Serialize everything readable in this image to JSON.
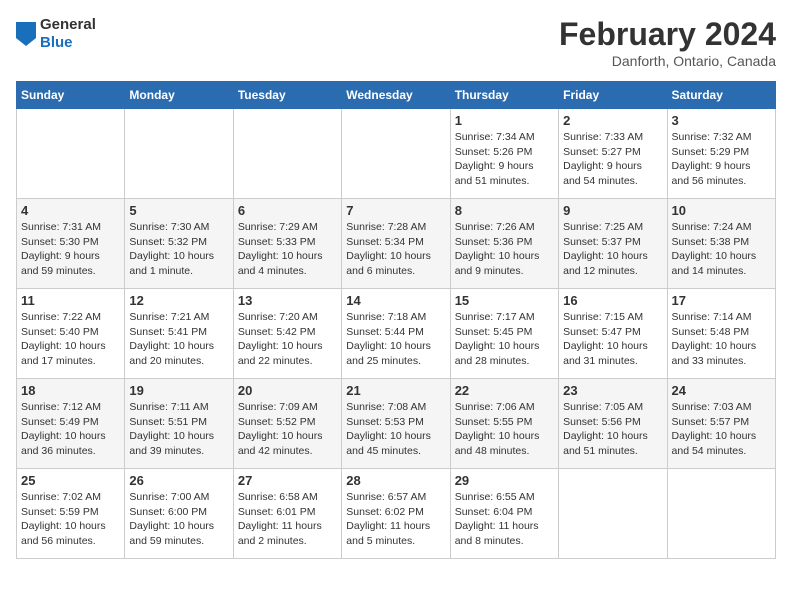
{
  "logo": {
    "line1": "General",
    "line2": "Blue"
  },
  "title": "February 2024",
  "subtitle": "Danforth, Ontario, Canada",
  "days_of_week": [
    "Sunday",
    "Monday",
    "Tuesday",
    "Wednesday",
    "Thursday",
    "Friday",
    "Saturday"
  ],
  "weeks": [
    [
      {
        "day": "",
        "info": ""
      },
      {
        "day": "",
        "info": ""
      },
      {
        "day": "",
        "info": ""
      },
      {
        "day": "",
        "info": ""
      },
      {
        "day": "1",
        "info": "Sunrise: 7:34 AM\nSunset: 5:26 PM\nDaylight: 9 hours\nand 51 minutes."
      },
      {
        "day": "2",
        "info": "Sunrise: 7:33 AM\nSunset: 5:27 PM\nDaylight: 9 hours\nand 54 minutes."
      },
      {
        "day": "3",
        "info": "Sunrise: 7:32 AM\nSunset: 5:29 PM\nDaylight: 9 hours\nand 56 minutes."
      }
    ],
    [
      {
        "day": "4",
        "info": "Sunrise: 7:31 AM\nSunset: 5:30 PM\nDaylight: 9 hours\nand 59 minutes."
      },
      {
        "day": "5",
        "info": "Sunrise: 7:30 AM\nSunset: 5:32 PM\nDaylight: 10 hours\nand 1 minute."
      },
      {
        "day": "6",
        "info": "Sunrise: 7:29 AM\nSunset: 5:33 PM\nDaylight: 10 hours\nand 4 minutes."
      },
      {
        "day": "7",
        "info": "Sunrise: 7:28 AM\nSunset: 5:34 PM\nDaylight: 10 hours\nand 6 minutes."
      },
      {
        "day": "8",
        "info": "Sunrise: 7:26 AM\nSunset: 5:36 PM\nDaylight: 10 hours\nand 9 minutes."
      },
      {
        "day": "9",
        "info": "Sunrise: 7:25 AM\nSunset: 5:37 PM\nDaylight: 10 hours\nand 12 minutes."
      },
      {
        "day": "10",
        "info": "Sunrise: 7:24 AM\nSunset: 5:38 PM\nDaylight: 10 hours\nand 14 minutes."
      }
    ],
    [
      {
        "day": "11",
        "info": "Sunrise: 7:22 AM\nSunset: 5:40 PM\nDaylight: 10 hours\nand 17 minutes."
      },
      {
        "day": "12",
        "info": "Sunrise: 7:21 AM\nSunset: 5:41 PM\nDaylight: 10 hours\nand 20 minutes."
      },
      {
        "day": "13",
        "info": "Sunrise: 7:20 AM\nSunset: 5:42 PM\nDaylight: 10 hours\nand 22 minutes."
      },
      {
        "day": "14",
        "info": "Sunrise: 7:18 AM\nSunset: 5:44 PM\nDaylight: 10 hours\nand 25 minutes."
      },
      {
        "day": "15",
        "info": "Sunrise: 7:17 AM\nSunset: 5:45 PM\nDaylight: 10 hours\nand 28 minutes."
      },
      {
        "day": "16",
        "info": "Sunrise: 7:15 AM\nSunset: 5:47 PM\nDaylight: 10 hours\nand 31 minutes."
      },
      {
        "day": "17",
        "info": "Sunrise: 7:14 AM\nSunset: 5:48 PM\nDaylight: 10 hours\nand 33 minutes."
      }
    ],
    [
      {
        "day": "18",
        "info": "Sunrise: 7:12 AM\nSunset: 5:49 PM\nDaylight: 10 hours\nand 36 minutes."
      },
      {
        "day": "19",
        "info": "Sunrise: 7:11 AM\nSunset: 5:51 PM\nDaylight: 10 hours\nand 39 minutes."
      },
      {
        "day": "20",
        "info": "Sunrise: 7:09 AM\nSunset: 5:52 PM\nDaylight: 10 hours\nand 42 minutes."
      },
      {
        "day": "21",
        "info": "Sunrise: 7:08 AM\nSunset: 5:53 PM\nDaylight: 10 hours\nand 45 minutes."
      },
      {
        "day": "22",
        "info": "Sunrise: 7:06 AM\nSunset: 5:55 PM\nDaylight: 10 hours\nand 48 minutes."
      },
      {
        "day": "23",
        "info": "Sunrise: 7:05 AM\nSunset: 5:56 PM\nDaylight: 10 hours\nand 51 minutes."
      },
      {
        "day": "24",
        "info": "Sunrise: 7:03 AM\nSunset: 5:57 PM\nDaylight: 10 hours\nand 54 minutes."
      }
    ],
    [
      {
        "day": "25",
        "info": "Sunrise: 7:02 AM\nSunset: 5:59 PM\nDaylight: 10 hours\nand 56 minutes."
      },
      {
        "day": "26",
        "info": "Sunrise: 7:00 AM\nSunset: 6:00 PM\nDaylight: 10 hours\nand 59 minutes."
      },
      {
        "day": "27",
        "info": "Sunrise: 6:58 AM\nSunset: 6:01 PM\nDaylight: 11 hours\nand 2 minutes."
      },
      {
        "day": "28",
        "info": "Sunrise: 6:57 AM\nSunset: 6:02 PM\nDaylight: 11 hours\nand 5 minutes."
      },
      {
        "day": "29",
        "info": "Sunrise: 6:55 AM\nSunset: 6:04 PM\nDaylight: 11 hours\nand 8 minutes."
      },
      {
        "day": "",
        "info": ""
      },
      {
        "day": "",
        "info": ""
      }
    ]
  ]
}
